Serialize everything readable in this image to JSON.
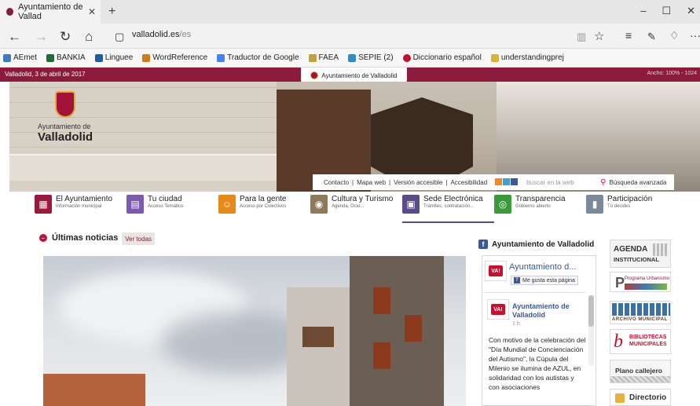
{
  "browser": {
    "tab_title": "Ayuntamiento de Vallad",
    "url_domain": "valladolid.es",
    "url_path": "/es",
    "new_tab": "+",
    "window_controls": [
      "–",
      "☐",
      "✕"
    ]
  },
  "bookmarks": [
    {
      "label": "AEmet",
      "color": "#3a7dc0"
    },
    {
      "label": "BANKIA",
      "color": "#1f6b3a"
    },
    {
      "label": "Linguee",
      "color": "#1b5fa0"
    },
    {
      "label": "WordReference",
      "color": "#d07a1b"
    },
    {
      "label": "Traductor de Google",
      "color": "#4285f4"
    },
    {
      "label": "FAEA",
      "color": "#c2a23a"
    },
    {
      "label": "SEPIE (2)",
      "color": "#2b8ec8"
    },
    {
      "label": "Diccionario español",
      "color": "#c8102e"
    },
    {
      "label": "understandingprej",
      "color": "#d8b33a"
    }
  ],
  "site": {
    "date": "Valladolid, 3 de abril de 2017",
    "top_right": "Ancho: 100% -  1024",
    "center_tab": "Ayuntamiento de Valladolid",
    "logo_line1": "Ayuntamiento de",
    "logo_line2": "Valladolid",
    "util": {
      "contacto": "Contacto",
      "mapa": "Mapa web",
      "accesible": "Versión accesible",
      "accesibilidad": "Accesibilidad",
      "search_placeholder": "buscar en la web",
      "advanced": "Búsqueda avanzada",
      "sep": "|"
    },
    "nav": [
      {
        "label": "El Ayuntamiento",
        "sub": "Información municipal",
        "color": "#9b1a3c",
        "glyph": "▦"
      },
      {
        "label": "Tu ciudad",
        "sub": "Acceso Temático",
        "color": "#7b5ab0",
        "glyph": "▤"
      },
      {
        "label": "Para la gente",
        "sub": "Acceso por Colectivos",
        "color": "#e88a1a",
        "glyph": "☺"
      },
      {
        "label": "Cultura y Turismo",
        "sub": "Agenda, Ocio...",
        "color": "#8c7a5a",
        "glyph": "◉"
      },
      {
        "label": "Sede Electrónica",
        "sub": "Trámites, contratación...",
        "color": "#5a4c8a",
        "glyph": "▣"
      },
      {
        "label": "Transparencia",
        "sub": "Gobierno abierto",
        "color": "#3a9a3a",
        "glyph": "◎"
      },
      {
        "label": "Participación",
        "sub": "Tú decides",
        "color": "#7a8a9a",
        "glyph": "▮"
      }
    ],
    "news_title": "Últimas noticias",
    "see_all": "Ver todas"
  },
  "facebook": {
    "header": "Ayuntamiento de Valladolid",
    "page_name": "Ayuntamiento d...",
    "like_button": "Me gusta esta página",
    "avatar_text": "VA!",
    "post_author": "Ayuntamiento de Valladolid",
    "post_time": "1 h",
    "post_text": "Con motivo de la celebración del \"Día Mundial de Concienciación del Autismo\", la Cúpula del Milenio se ilumina de AZUL, en solidaridad con los autistas y con asociaciones"
  },
  "tiles": {
    "agenda1": "AGENDA",
    "agenda2": "INSTITUCIONAL",
    "pgou": "Programa Urbanismo",
    "archivo": "ARCHIVO MUNICIPAL",
    "bib1": "BIBLIOTECAS",
    "bib2": "MUNICIPALES",
    "callejero": "Plano callejero",
    "directorio": "Directorio"
  }
}
